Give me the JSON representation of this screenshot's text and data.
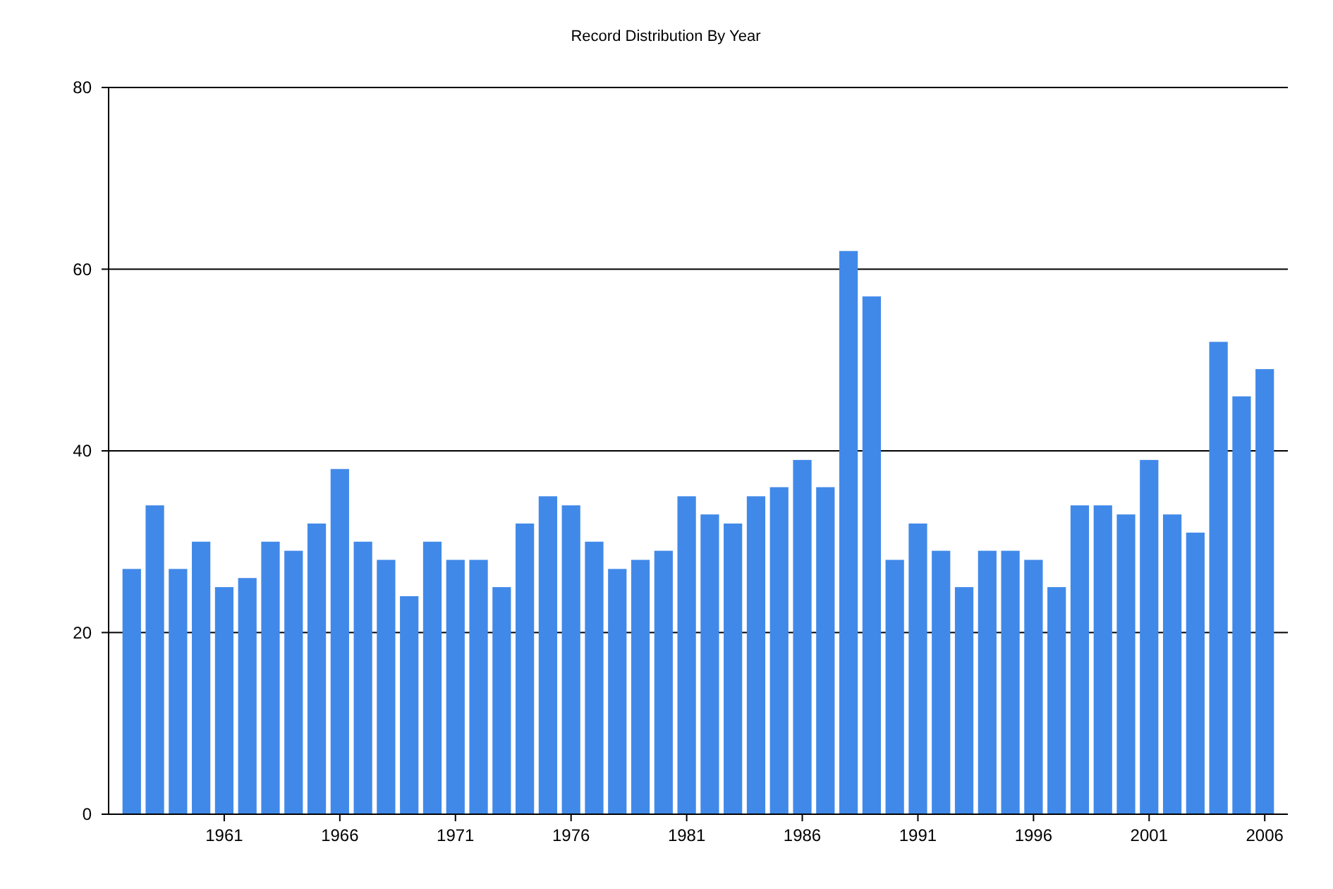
{
  "chart": {
    "chart_data": {
      "type": "bar",
      "title": "Record Distribution By Year",
      "x": [
        1957,
        1958,
        1959,
        1960,
        1961,
        1962,
        1963,
        1964,
        1965,
        1966,
        1967,
        1968,
        1969,
        1970,
        1971,
        1972,
        1973,
        1974,
        1975,
        1976,
        1977,
        1978,
        1979,
        1980,
        1981,
        1982,
        1983,
        1984,
        1985,
        1986,
        1987,
        1988,
        1989,
        1990,
        1991,
        1992,
        1993,
        1994,
        1995,
        1996,
        1997,
        1998,
        1999,
        2000,
        2001,
        2002,
        2003,
        2004,
        2005,
        2006
      ],
      "series": [
        {
          "color": "#4189e9",
          "values": [
            27,
            34,
            27,
            30,
            25,
            26,
            30,
            29,
            32,
            38,
            30,
            28,
            24,
            30,
            28,
            28,
            25,
            32,
            35,
            34,
            30,
            27,
            28,
            29,
            35,
            33,
            32,
            35,
            36,
            39,
            36,
            62,
            57,
            28,
            32,
            29,
            25,
            29,
            29,
            28,
            25,
            34,
            34,
            33,
            39,
            33,
            31,
            52,
            46,
            49
          ]
        }
      ],
      "xlim": [
        1956,
        2007
      ],
      "ylim": [
        0,
        80
      ],
      "xticks": [
        1961,
        1966,
        1971,
        1976,
        1981,
        1986,
        1991,
        1996,
        2001,
        2006
      ],
      "yticks": [
        0,
        20,
        40,
        60,
        80
      ],
      "grid": true
    }
  }
}
